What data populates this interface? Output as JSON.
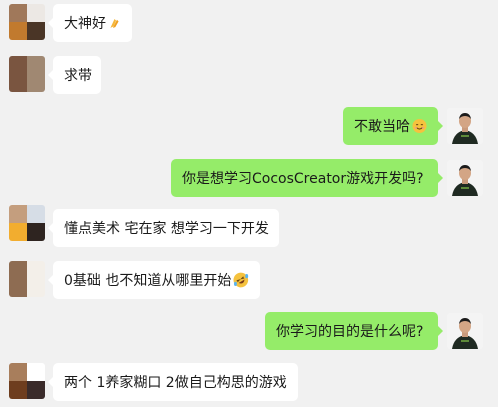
{
  "messages": [
    {
      "side": "left",
      "text": "大神好",
      "emoji": "pray-hands-icon"
    },
    {
      "side": "left",
      "text": "求带"
    },
    {
      "side": "right",
      "text": "不敢当哈",
      "emoji": "smiling-face-icon"
    },
    {
      "side": "right",
      "text": "你是想学习CocosCreator游戏开发吗?"
    },
    {
      "side": "left",
      "text": "懂点美术 宅在家 想学习一下开发"
    },
    {
      "side": "left",
      "text": "0基础 也不知道从哪里开始",
      "emoji": "rofl-face-icon"
    },
    {
      "side": "right",
      "text": "你学习的目的是什么呢?"
    },
    {
      "side": "left",
      "text": "两个 1养家糊口 2做自己构思的游戏"
    }
  ],
  "colors": {
    "background": "#f1f1f1",
    "incoming_bubble": "#ffffff",
    "outgoing_bubble": "#95ec69"
  }
}
